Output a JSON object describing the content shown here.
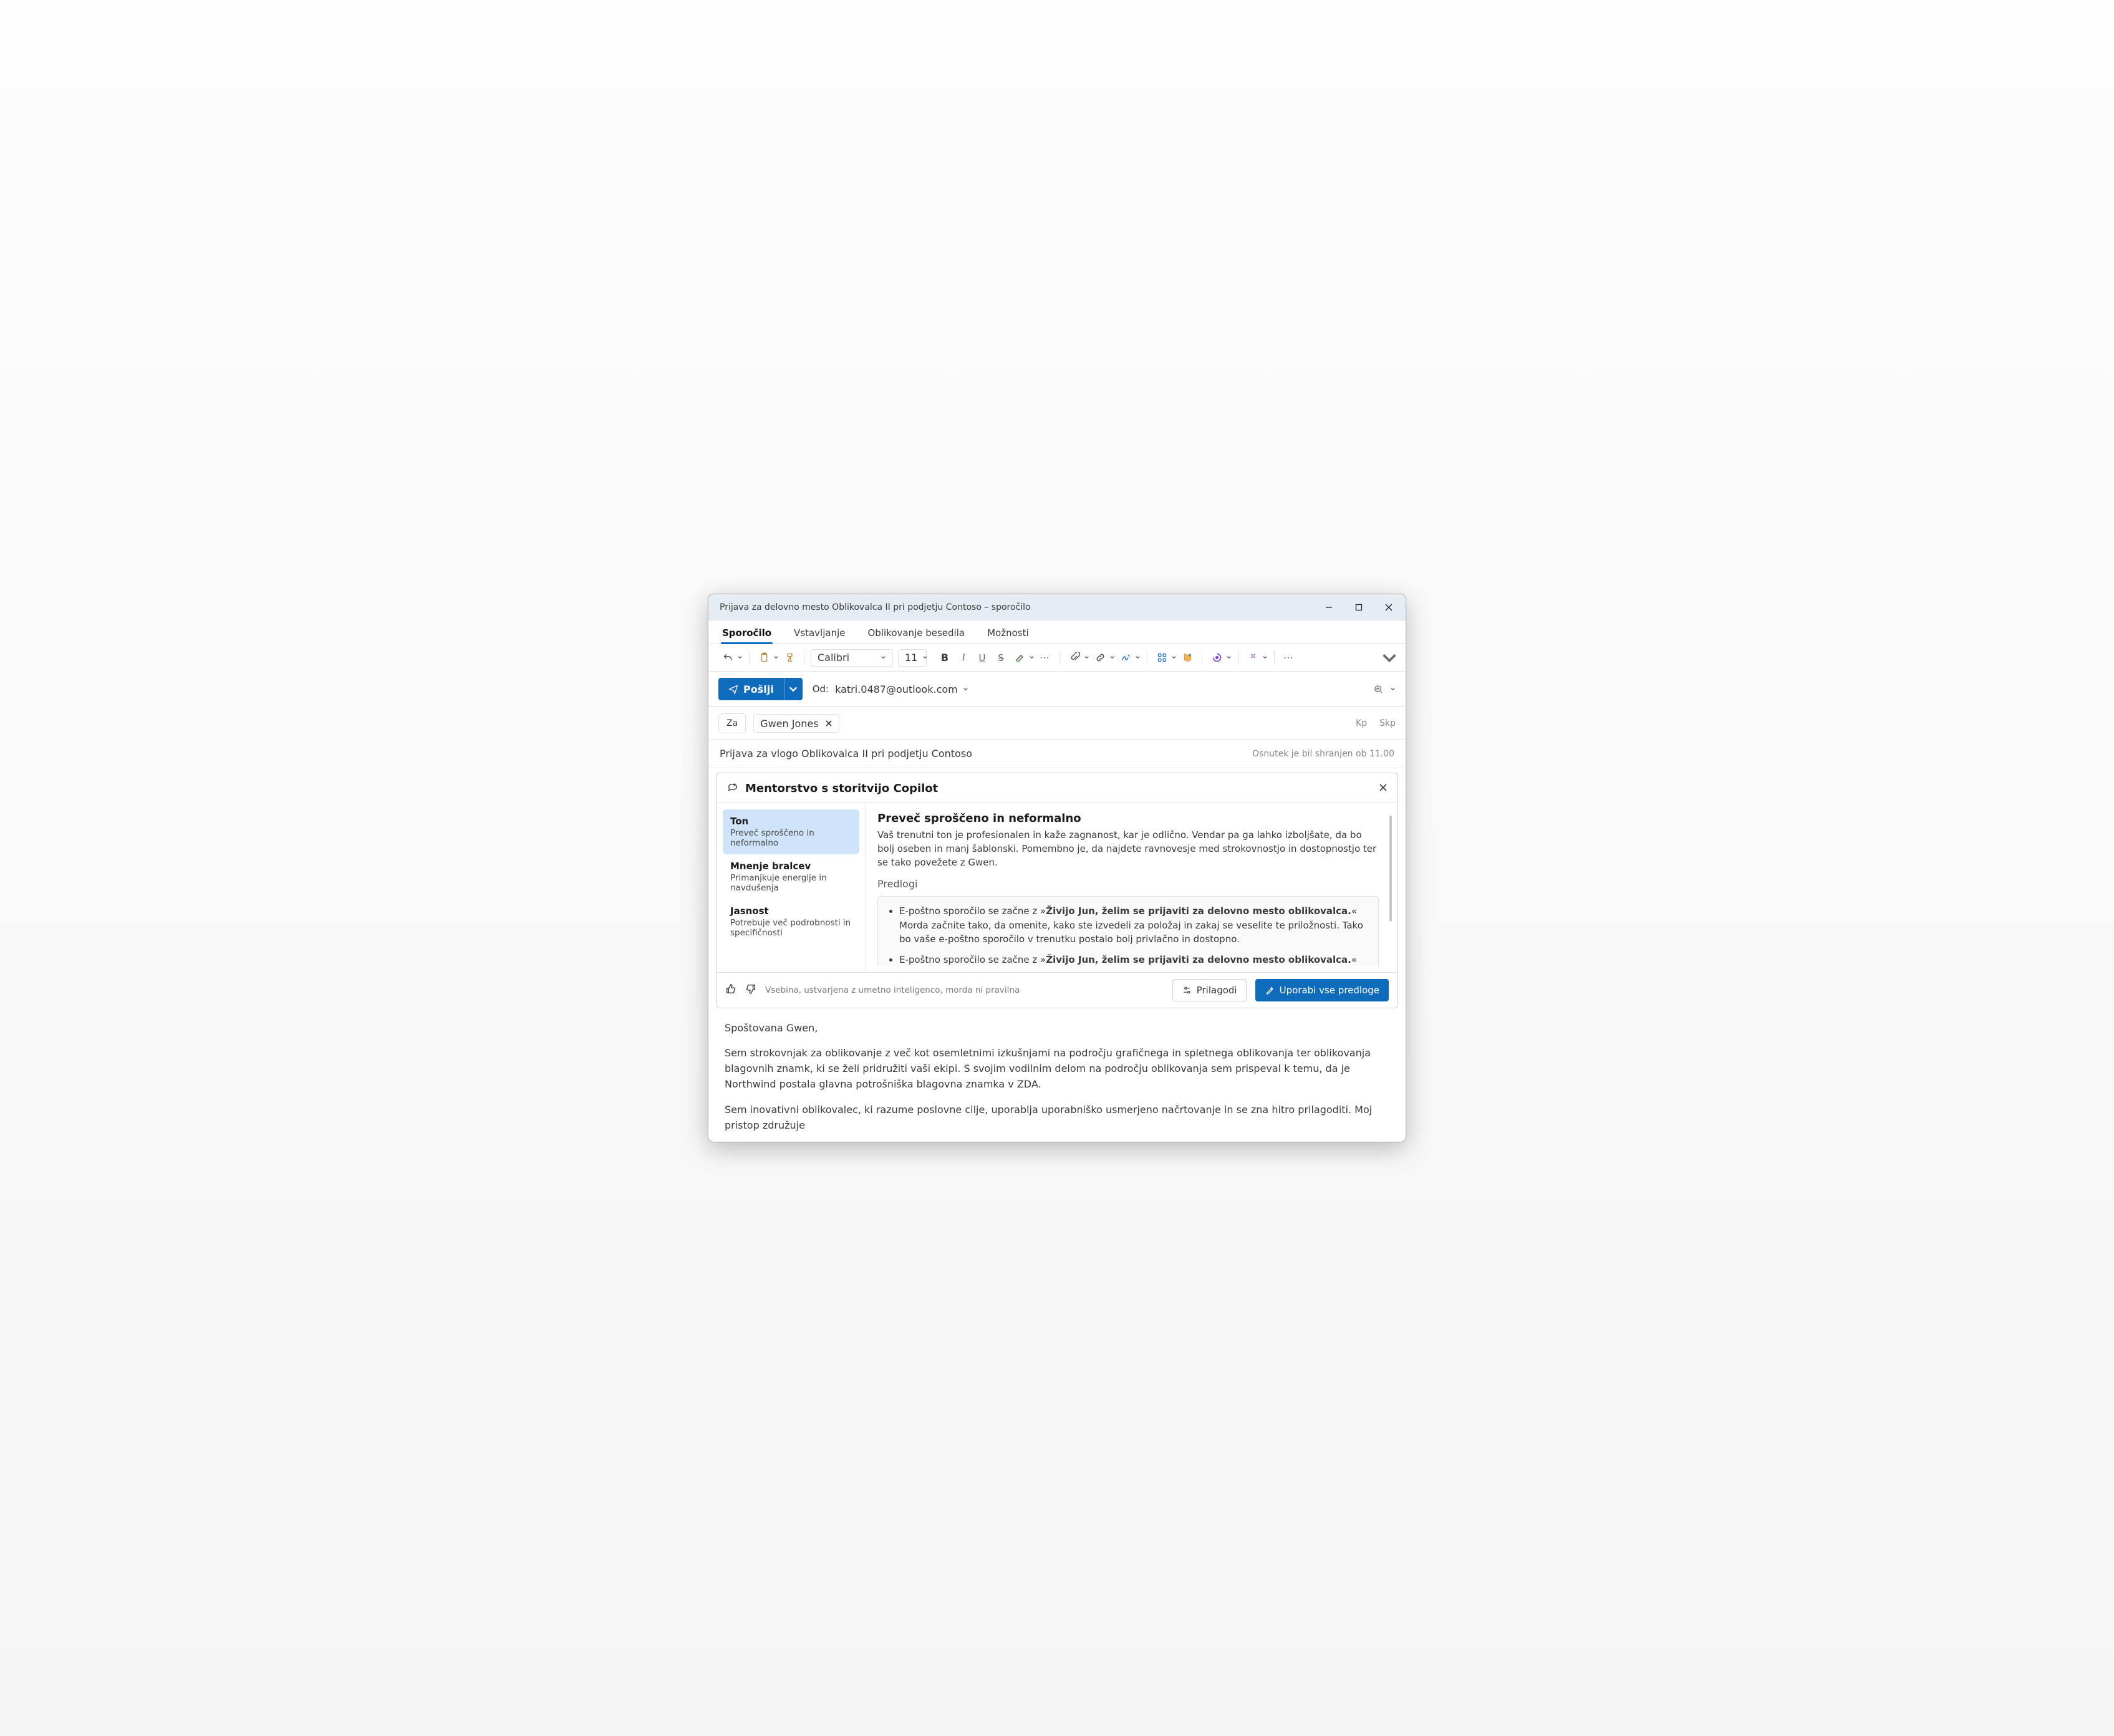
{
  "window_title": "Prijava za delovno mesto Oblikovalca II pri podjetju Contoso – sporočilo",
  "tabs": {
    "compose": "Sporočilo",
    "insert": "Vstavljanje",
    "format": "Oblikovanje besedila",
    "options": "Možnosti"
  },
  "toolbar": {
    "font_name": "Calibri",
    "font_size": "11"
  },
  "send": {
    "label": "Pošlji",
    "from_label": "Od:",
    "from_addr": "katri.0487@outlook.com"
  },
  "to": {
    "label": "Za",
    "recipient": "Gwen Jones",
    "cc": "Kp",
    "bcc": "Skp"
  },
  "subject": "Prijava za vlogo Oblikovalca II pri podjetju Contoso",
  "draft_status": "Osnutek je bil shranjen ob 11.00",
  "copilot": {
    "title": "Mentorstvo s storitvijo Copilot",
    "topics": [
      {
        "title": "Ton",
        "sub": "Preveč sproščeno in neformalno"
      },
      {
        "title": "Mnenje bralcev",
        "sub": "Primanjkuje energije in navdušenja"
      },
      {
        "title": "Jasnost",
        "sub": "Potrebuje več podrobnosti in specifičnosti"
      }
    ],
    "heading": "Preveč sproščeno in neformalno",
    "paragraph": "Vaš trenutni ton je profesionalen in kaže zagnanost, kar je odlično. Vendar pa ga lahko izboljšate, da bo bolj oseben in manj šablonski. Pomembno je, da najdete ravnovesje med strokovnostjo in dostopnostjo ter se tako povežete z Gwen.",
    "suggestions_label": "Predlogi",
    "sugg1_pre": "E-poštno sporočilo se začne z »",
    "sugg1_bold": "Živijo Jun, želim se prijaviti za delovno mesto oblikovalca.",
    "sugg1_post": "« Morda začnite tako, da omenite, kako ste izvedeli za položaj in zakaj se veselite te priložnosti. Tako bo vaše e-poštno sporočilo v trenutku postalo bolj privlačno in dostopno.",
    "sugg2_pre": "E-poštno sporočilo se začne z »",
    "sugg2_bold": "Živijo Jun, želim se prijaviti za delovno mesto oblikovalca.",
    "sugg2_post": "« Morda začnite tako,",
    "disclaimer": "Vsebina, ustvarjena z umetno inteligenco, morda ni pravilna",
    "adjust": "Prilagodi",
    "apply": "Uporabi vse predloge"
  },
  "body": {
    "greeting": "Spoštovana Gwen,",
    "p1": "Sem strokovnjak za oblikovanje z več kot osemletnimi izkušnjami na področju grafičnega in spletnega oblikovanja ter oblikovanja blagovnih znamk, ki se želi pridružiti vaši ekipi. S svojim vodilnim delom na področju oblikovanja sem prispeval k temu, da je Northwind postala glavna potrošniška blagovna znamka v ZDA.",
    "p2": "Sem inovativni oblikovalec, ki razume poslovne cilje, uporablja uporabniško usmerjeno načrtovanje in se zna hitro prilagoditi. Moj pristop združuje"
  }
}
